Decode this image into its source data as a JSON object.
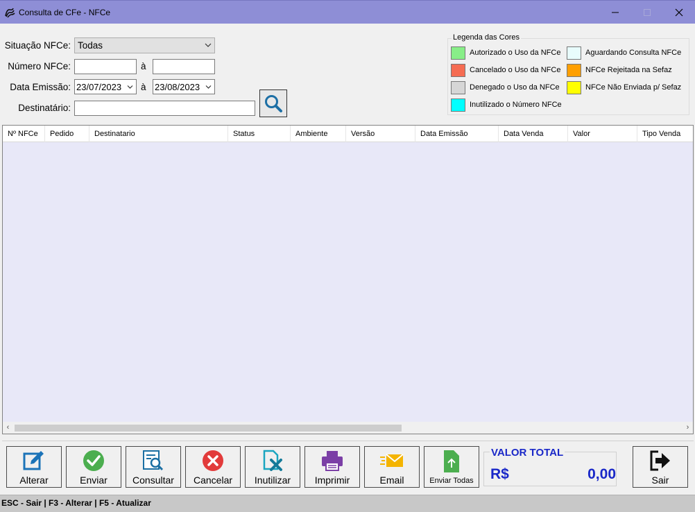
{
  "window": {
    "title": "Consulta de CFe - NFCe",
    "title_color": "#8e8ed6"
  },
  "filters": {
    "situacao_label": "Situação NFCe:",
    "situacao_value": "Todas",
    "numero_label": "Número NFCe:",
    "numero_from": "",
    "numero_to": "",
    "a_sep": "à",
    "data_label": "Data Emissão:",
    "data_from": "23/07/2023",
    "data_to": "23/08/2023",
    "destinatario_label": "Destinatário:",
    "destinatario_value": ""
  },
  "legend": {
    "title": "Legenda das Cores",
    "items": [
      {
        "label": "Autorizado o Uso da NFCe",
        "color": "#88ee88"
      },
      {
        "label": "Cancelado o Uso da NFCe",
        "color": "#f56c52"
      },
      {
        "label": "Denegado o Uso da NFCe",
        "color": "#d6d6d6"
      },
      {
        "label": "Inutilizado o Número NFCe",
        "color": "#00ffff"
      },
      {
        "label": "Aguardando Consulta NFCe",
        "color": "#e8fcfc"
      },
      {
        "label": "NFCe Rejeitada na Sefaz",
        "color": "#ff9f00"
      },
      {
        "label": "NFCe Não Enviada p/ Sefaz",
        "color": "#ffff00"
      }
    ]
  },
  "grid": {
    "columns": [
      "Nº NFCe",
      "Pedido",
      "Destinatario",
      "Status",
      "Ambiente",
      "Versão",
      "Data Emissão",
      "Data Venda",
      "Valor",
      "Tipo Venda"
    ],
    "rows": []
  },
  "actions": {
    "alterar": "Alterar",
    "enviar": "Enviar",
    "consultar": "Consultar",
    "cancelar": "Cancelar",
    "inutilizar": "Inutilizar",
    "imprimir": "Imprimir",
    "email": "Email",
    "enviar_todas": "Enviar Todas",
    "sair": "Sair"
  },
  "total": {
    "title": "VALOR TOTAL",
    "currency": "R$",
    "value": "0,00"
  },
  "status_bar": "ESC - Sair | F3 - Alterar  |  F5 - Atualizar"
}
